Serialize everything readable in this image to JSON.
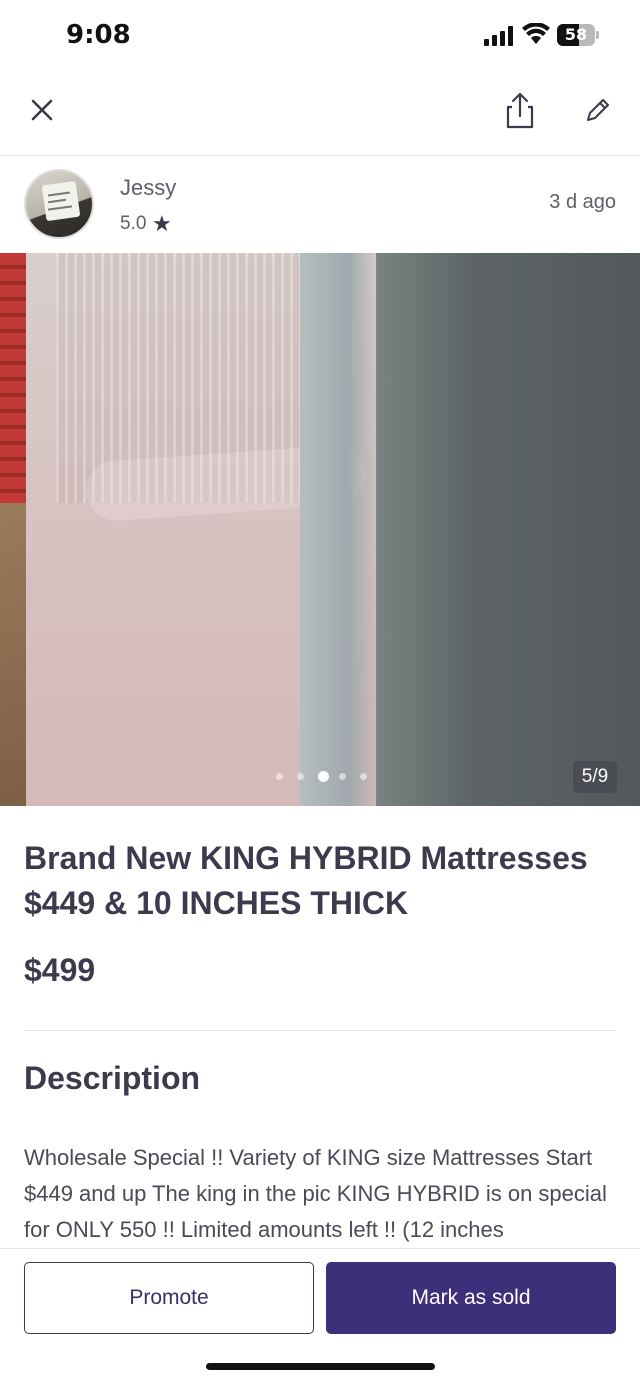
{
  "status_bar": {
    "time": "9:08",
    "battery": "58",
    "battery_level": 0.58
  },
  "nav": {
    "close": "close-icon",
    "share": "share-icon",
    "edit": "edit-pencil-icon"
  },
  "seller": {
    "name": "Jessy",
    "rating": "5.0",
    "posted": "3 d ago"
  },
  "gallery": {
    "counter": "5/9",
    "dots": 5,
    "active_dot": 3
  },
  "listing": {
    "title": "Brand New KING HYBRID Mattresses $449 & 10 INCHES THICK",
    "price": "$499",
    "description_heading": "Description",
    "description": "Wholesale Special !! Variety of KING size Mattresses Start $449 and up The king in the pic KING HYBRID is on special for ONLY 550 !! Limited amounts left !! (12 inches"
  },
  "actions": {
    "promote": "Promote",
    "mark_sold": "Mark as sold"
  },
  "colors": {
    "primary": "#3d2f7a",
    "text": "#3b3b4d"
  }
}
